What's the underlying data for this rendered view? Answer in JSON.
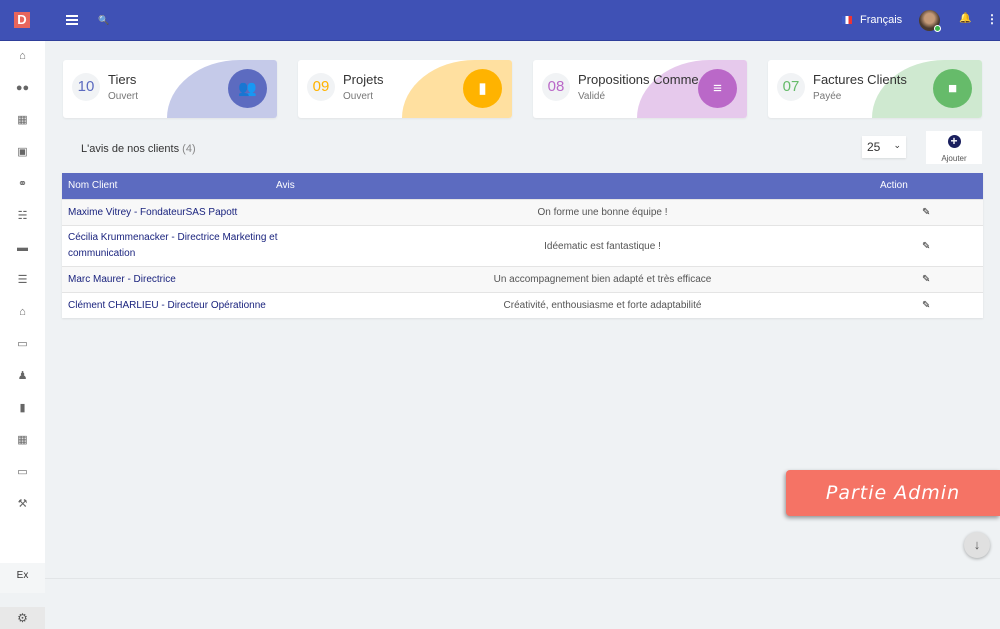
{
  "header": {
    "logo": "D",
    "language": "Français"
  },
  "sidebar": {
    "icons": [
      "home-icon",
      "users-icon",
      "building-icon",
      "box-icon",
      "handshake-icon",
      "sitemap-icon",
      "briefcase-icon",
      "coins-icon",
      "bank-icon",
      "money-icon",
      "user-tie-icon",
      "folder-open-icon",
      "calendar-icon",
      "ticket-icon",
      "wrench-icon"
    ],
    "ex_label": "Ex"
  },
  "cards": [
    {
      "number": "10",
      "title": "Tiers",
      "subtitle": "Ouvert",
      "color": "#5c6bc0",
      "wave": "#c5cae9",
      "icon": "users-icon",
      "glyph": "👥"
    },
    {
      "number": "09",
      "title": "Projets",
      "subtitle": "Ouvert",
      "color": "#ffb300",
      "wave": "#ffe0a0",
      "icon": "file-icon",
      "glyph": "▮"
    },
    {
      "number": "08",
      "title": "Propositions Comme",
      "subtitle": "Validé",
      "color": "#ba68c8",
      "wave": "#e6c9ec",
      "icon": "document-icon",
      "glyph": "≡"
    },
    {
      "number": "07",
      "title": "Factures Clients",
      "subtitle": "Payée",
      "color": "#66bb6a",
      "wave": "#cfe9d0",
      "icon": "folder-icon",
      "glyph": "■"
    }
  ],
  "section": {
    "title": "L'avis de nos clients",
    "count": "(4)",
    "page_size": "25",
    "add_label": "Ajouter"
  },
  "table": {
    "headers": {
      "name": "Nom Client",
      "avis": "Avis",
      "action": "Action"
    },
    "rows": [
      {
        "name": "Maxime Vitrey - FondateurSAS Papott",
        "avis": "On forme une bonne équipe !"
      },
      {
        "name": "Cécilia Krummenacker - Directrice Marketing et communication",
        "avis": "Idéematic est fantastique !"
      },
      {
        "name": "Marc Maurer - Directrice",
        "avis": "Un accompagnement bien adapté et très efficace"
      },
      {
        "name": "Clément CHARLIEU - Directeur Opérationne",
        "avis": "Créativité, enthousiasme et forte adaptabilité"
      }
    ]
  },
  "banner": {
    "label": "Partie Admin"
  }
}
